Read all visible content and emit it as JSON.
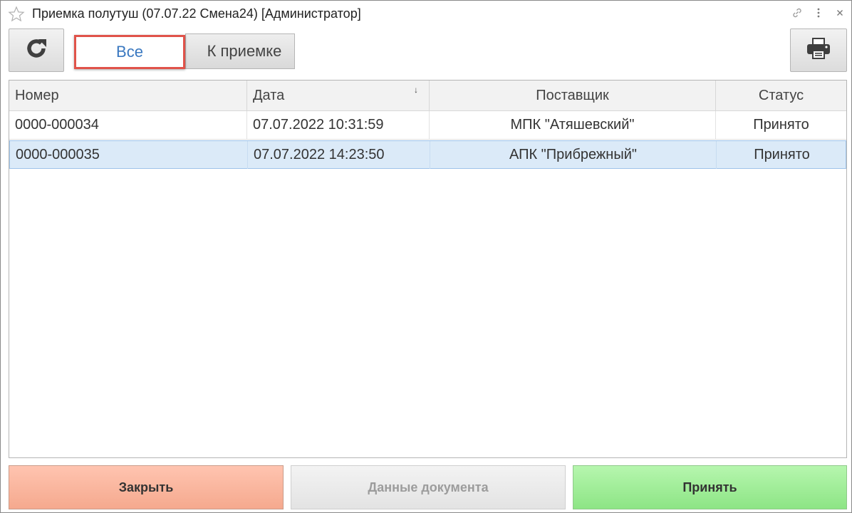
{
  "window": {
    "title": "Приемка полутуш (07.07.22 Смена24) [Администратор]",
    "icons": [
      "star-icon",
      "link-icon",
      "more-icon",
      "close-icon"
    ]
  },
  "toolbar": {
    "refresh_icon": "refresh-icon",
    "filter_all_label": "Все",
    "filter_pending_label": "К приемке",
    "print_icon": "printer-icon"
  },
  "table": {
    "columns": [
      "Номер",
      "Дата",
      "Поставщик",
      "Статус"
    ],
    "sort_indicator": "↓",
    "rows": [
      {
        "number": "0000-000034",
        "date": "07.07.2022 10:31:59",
        "supplier": "МПК \"Атяшевский\"",
        "status": "Принято",
        "selected": false
      },
      {
        "number": "0000-000035",
        "date": "07.07.2022 14:23:50",
        "supplier": "АПК \"Прибрежный\"",
        "status": "Принято",
        "selected": true
      }
    ]
  },
  "footer": {
    "close_label": "Закрыть",
    "document_label": "Данные документа",
    "accept_label": "Принять"
  },
  "colors": {
    "accent_blue": "#3a78c0",
    "highlight_red": "#e0534a",
    "close_bg": "#f5a98e",
    "accept_bg": "#8de585",
    "selected_row": "#dbeaf8"
  }
}
